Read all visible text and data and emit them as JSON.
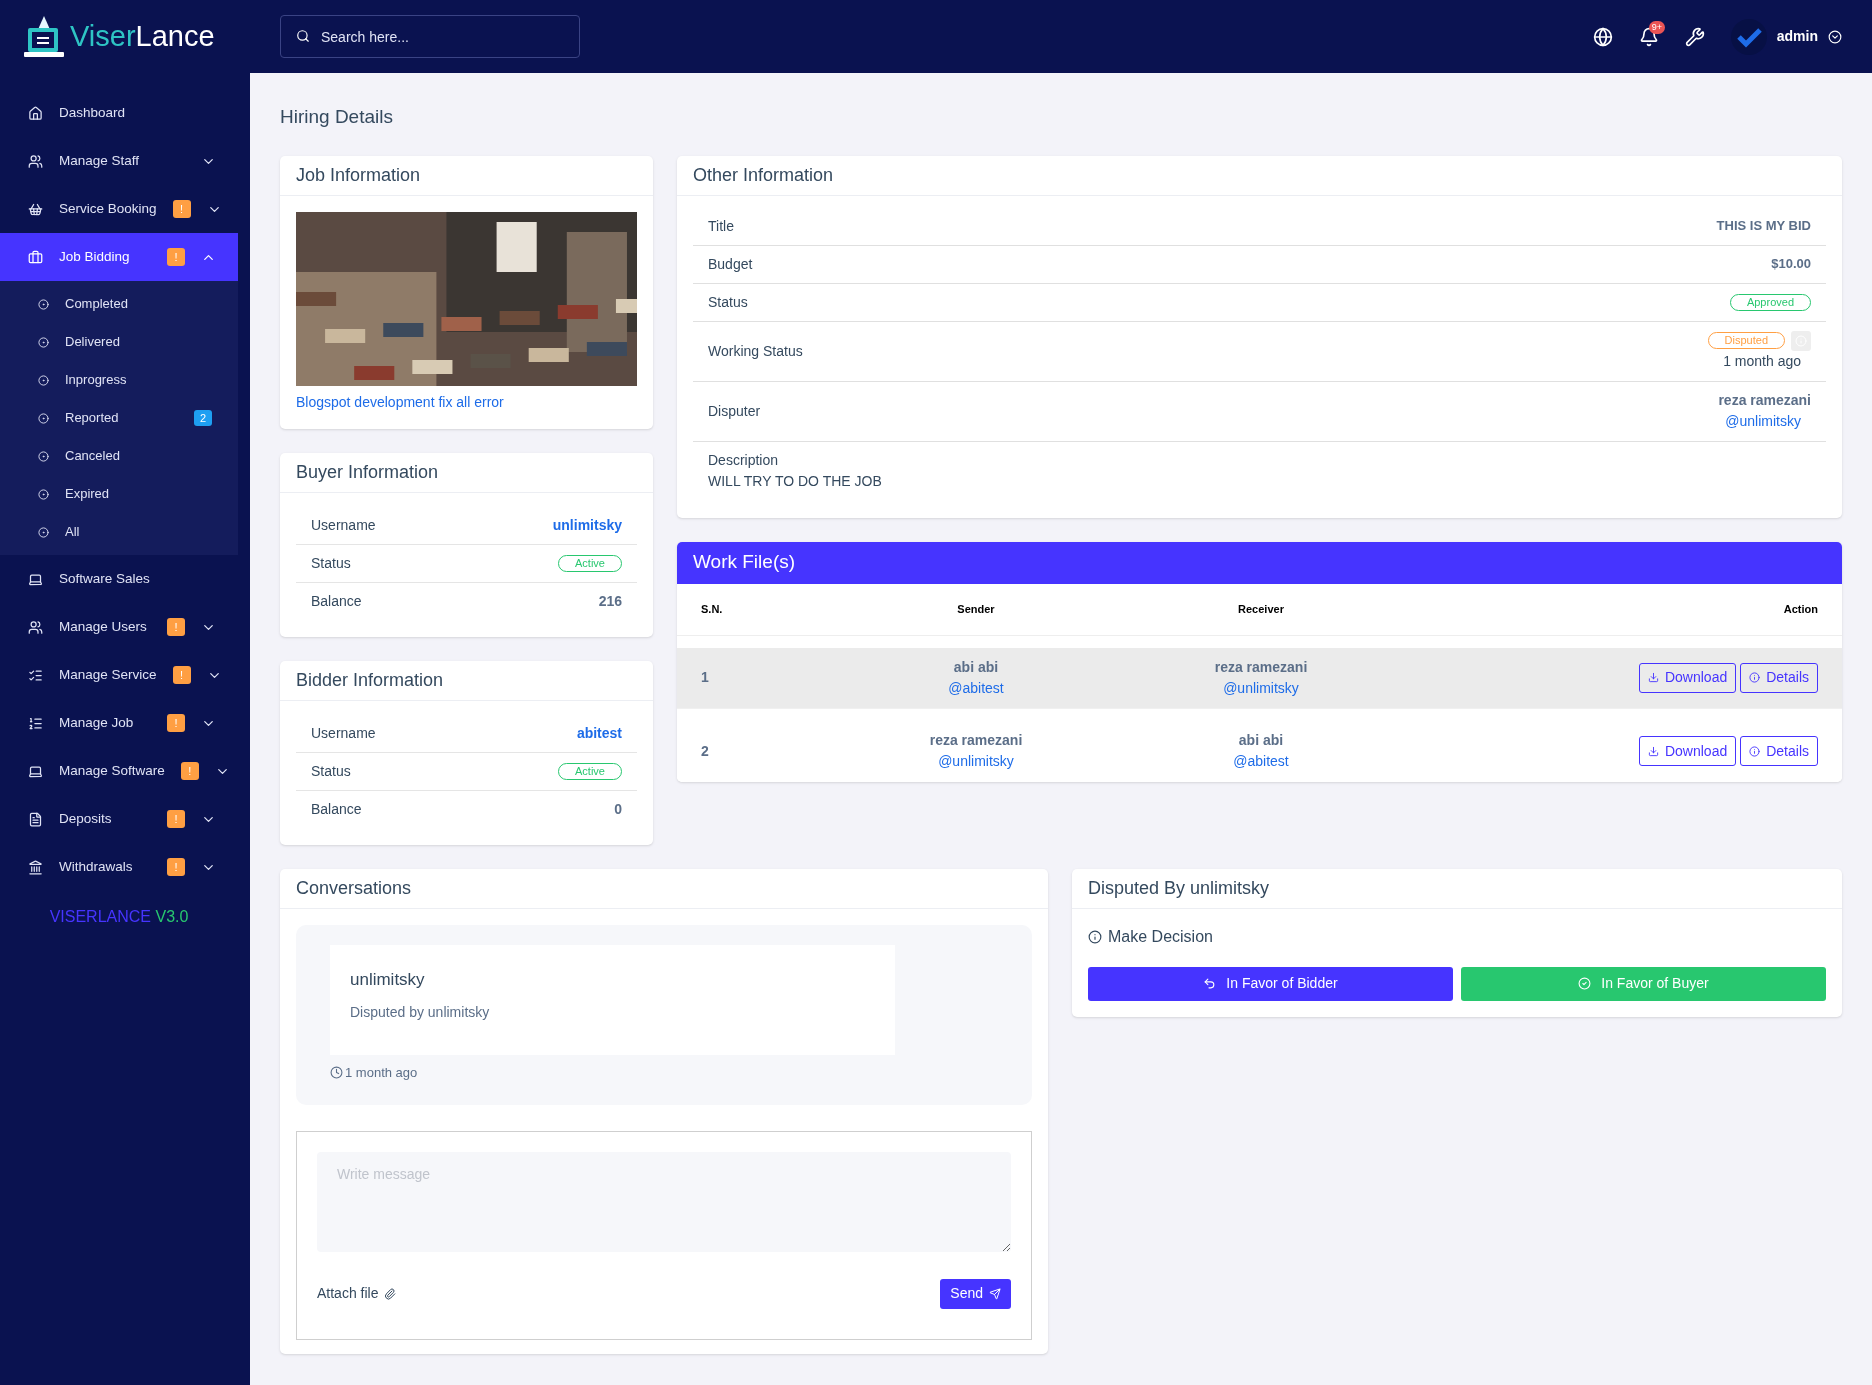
{
  "logo": {
    "part_1": "Viser",
    "part_2": "Lance"
  },
  "sidebar": {
    "items": [
      {
        "label": "Dashboard",
        "selected": false
      },
      {
        "label": "Manage Staff",
        "selected": false,
        "expanded": false
      },
      {
        "label": "Service Booking",
        "badge": "!",
        "selected": false,
        "expanded": false
      },
      {
        "label": "Job Bidding",
        "badge": "!",
        "selected": true,
        "expanded": true,
        "children": [
          {
            "label": "Completed"
          },
          {
            "label": "Delivered"
          },
          {
            "label": "Inprogress"
          },
          {
            "label": "Reported",
            "badge": "2"
          },
          {
            "label": "Canceled"
          },
          {
            "label": "Expired"
          },
          {
            "label": "All"
          }
        ]
      },
      {
        "label": "Software Sales",
        "selected": false
      },
      {
        "label": "Manage Users",
        "badge": "!",
        "selected": false,
        "expanded": false
      },
      {
        "label": "Manage Service",
        "badge": "!",
        "selected": false,
        "expanded": false
      },
      {
        "label": "Manage Job",
        "badge": "!",
        "selected": false,
        "expanded": false
      },
      {
        "label": "Manage Software",
        "badge": "!",
        "selected": false,
        "expanded": false
      },
      {
        "label": "Deposits",
        "badge": "!",
        "selected": false,
        "expanded": false
      },
      {
        "label": "Withdrawals",
        "badge": "!",
        "selected": false,
        "expanded": false
      }
    ],
    "version": {
      "name": "VISERLANCE",
      "number": "V3.0"
    }
  },
  "header": {
    "search": {
      "placeholder": "Search here..."
    },
    "notification_badge": "9+",
    "user": "admin"
  },
  "page_title": "Hiring Details",
  "job_information": {
    "title": "Job Information",
    "link": "Blogspot development fix all error"
  },
  "buyer_information": {
    "title": "Buyer Information",
    "rows": [
      {
        "label": "Username",
        "value": "unlimitsky",
        "kind": "link"
      },
      {
        "label": "Status",
        "value": "Active",
        "kind": "badge"
      },
      {
        "label": "Balance",
        "value": "216",
        "kind": "text"
      }
    ]
  },
  "bidder_information": {
    "title": "Bidder Information",
    "rows": [
      {
        "label": "Username",
        "value": "abitest",
        "kind": "link"
      },
      {
        "label": "Status",
        "value": "Active",
        "kind": "badge"
      },
      {
        "label": "Balance",
        "value": "0",
        "kind": "text"
      }
    ]
  },
  "other_information": {
    "title": "Other Information",
    "rows": [
      {
        "label": "Title",
        "kind": "text",
        "value": "THIS IS MY BID"
      },
      {
        "label": "Budget",
        "kind": "text",
        "value": "$10.00"
      },
      {
        "label": "Status",
        "kind": "badge",
        "value": "Approved",
        "color": "#28c76f"
      },
      {
        "label": "Working Status",
        "kind": "badge_time",
        "value": "Disputed",
        "color": "#ff9f43",
        "time": "1 month ago"
      },
      {
        "label": "Disputer",
        "kind": "user",
        "value": "reza ramezani",
        "username": "@unlimitsky"
      },
      {
        "label": "Description",
        "kind": "block",
        "value": "WILL TRY TO DO THE JOB"
      }
    ]
  },
  "work_files": {
    "title": "Work File(s)",
    "columns": [
      "S.N.",
      "Sender",
      "Receiver",
      "Action"
    ],
    "rows": [
      {
        "sn": "1",
        "sender": "abi abi",
        "sender_username": "@abitest",
        "receiver": "reza ramezani",
        "receiver_username": "@unlimitsky",
        "selected": true,
        "actions": [
          "Download",
          "Details"
        ]
      },
      {
        "sn": "2",
        "sender": "reza ramezani",
        "sender_username": "@unlimitsky",
        "receiver": "abi abi",
        "receiver_username": "@abitest",
        "selected": false,
        "actions": [
          "Download",
          "Details"
        ]
      }
    ]
  },
  "conversations": {
    "title": "Conversations",
    "messages": [
      {
        "sender": "unlimitsky",
        "text": "Disputed by unlimitsky",
        "time": "1 month ago"
      }
    ],
    "message_field": {
      "placeholder": "Write message"
    },
    "attach_label": "Attach file",
    "send_label": "Send"
  },
  "dispute": {
    "title": "Disputed By unlimitsky",
    "subtitle": "Make Decision",
    "buttons": [
      {
        "label": "In Favor of Bidder",
        "kind": "bidder"
      },
      {
        "label": "In Favor of Buyer",
        "kind": "buyer"
      }
    ]
  }
}
